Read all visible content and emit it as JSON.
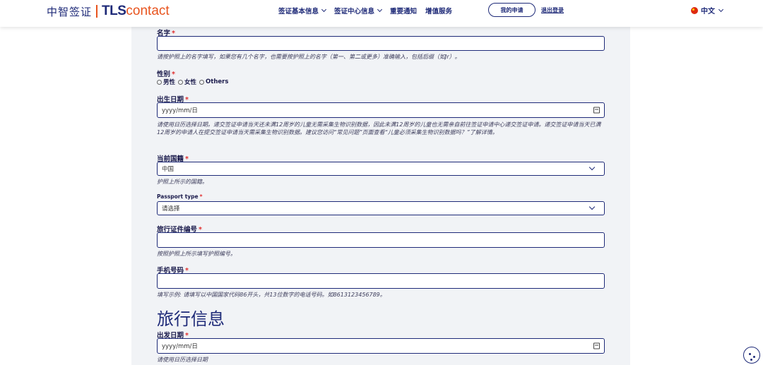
{
  "header": {
    "logo_zh": "中智签证",
    "logo_tls": "TLS",
    "logo_contact": "contact",
    "nav": [
      "签证基本信息",
      "签证中心信息",
      "重要通知",
      "增值服务"
    ],
    "my_application": "我的申请",
    "logout": "退出登录",
    "language": "中文"
  },
  "form": {
    "name": {
      "label": "名字",
      "help": "请按护照上的名字填写，如果您有几个名字，也需要按护照上的名字（第一、第二或更多）准确输入，包括后缀（如Jr）。"
    },
    "gender": {
      "label": "性别",
      "options": [
        "男性",
        "女性",
        "Others"
      ]
    },
    "dob": {
      "label": "出生日期",
      "placeholder": "yyyy/mm/日",
      "help": "请使用日历选择日期。递交签证申请当天还未满12周岁的儿童无需采集生物识别数据，因此未满12周岁的儿童也无需亲自前往签证申请中心递交签证申请。递交签证申请当天已满12周岁的申请人在提交签证申请当天需采集生物识别数据。建议您访问“常见问题”页面查看“儿童必须采集生物识别数据吗？”了解详情。"
    },
    "nationality": {
      "label": "当前国籍",
      "value": "中国",
      "help": "护照上所示的国籍。"
    },
    "passport_type": {
      "label": "Passport type",
      "value": "请选择"
    },
    "travel_doc": {
      "label": "旅行证件编号",
      "help": "按照护照上所示填写护照编号。"
    },
    "phone": {
      "label": "手机号码",
      "help": "填写示例: 请填写以中国国家代码86开头，共13位数字的电话号码。如8613123456789。"
    },
    "travel_section_title": "旅行信息",
    "departure": {
      "label": "出发日期",
      "placeholder": "yyyy/mm/日",
      "help": "请使用日历选择日期"
    },
    "required_mark": "*"
  }
}
